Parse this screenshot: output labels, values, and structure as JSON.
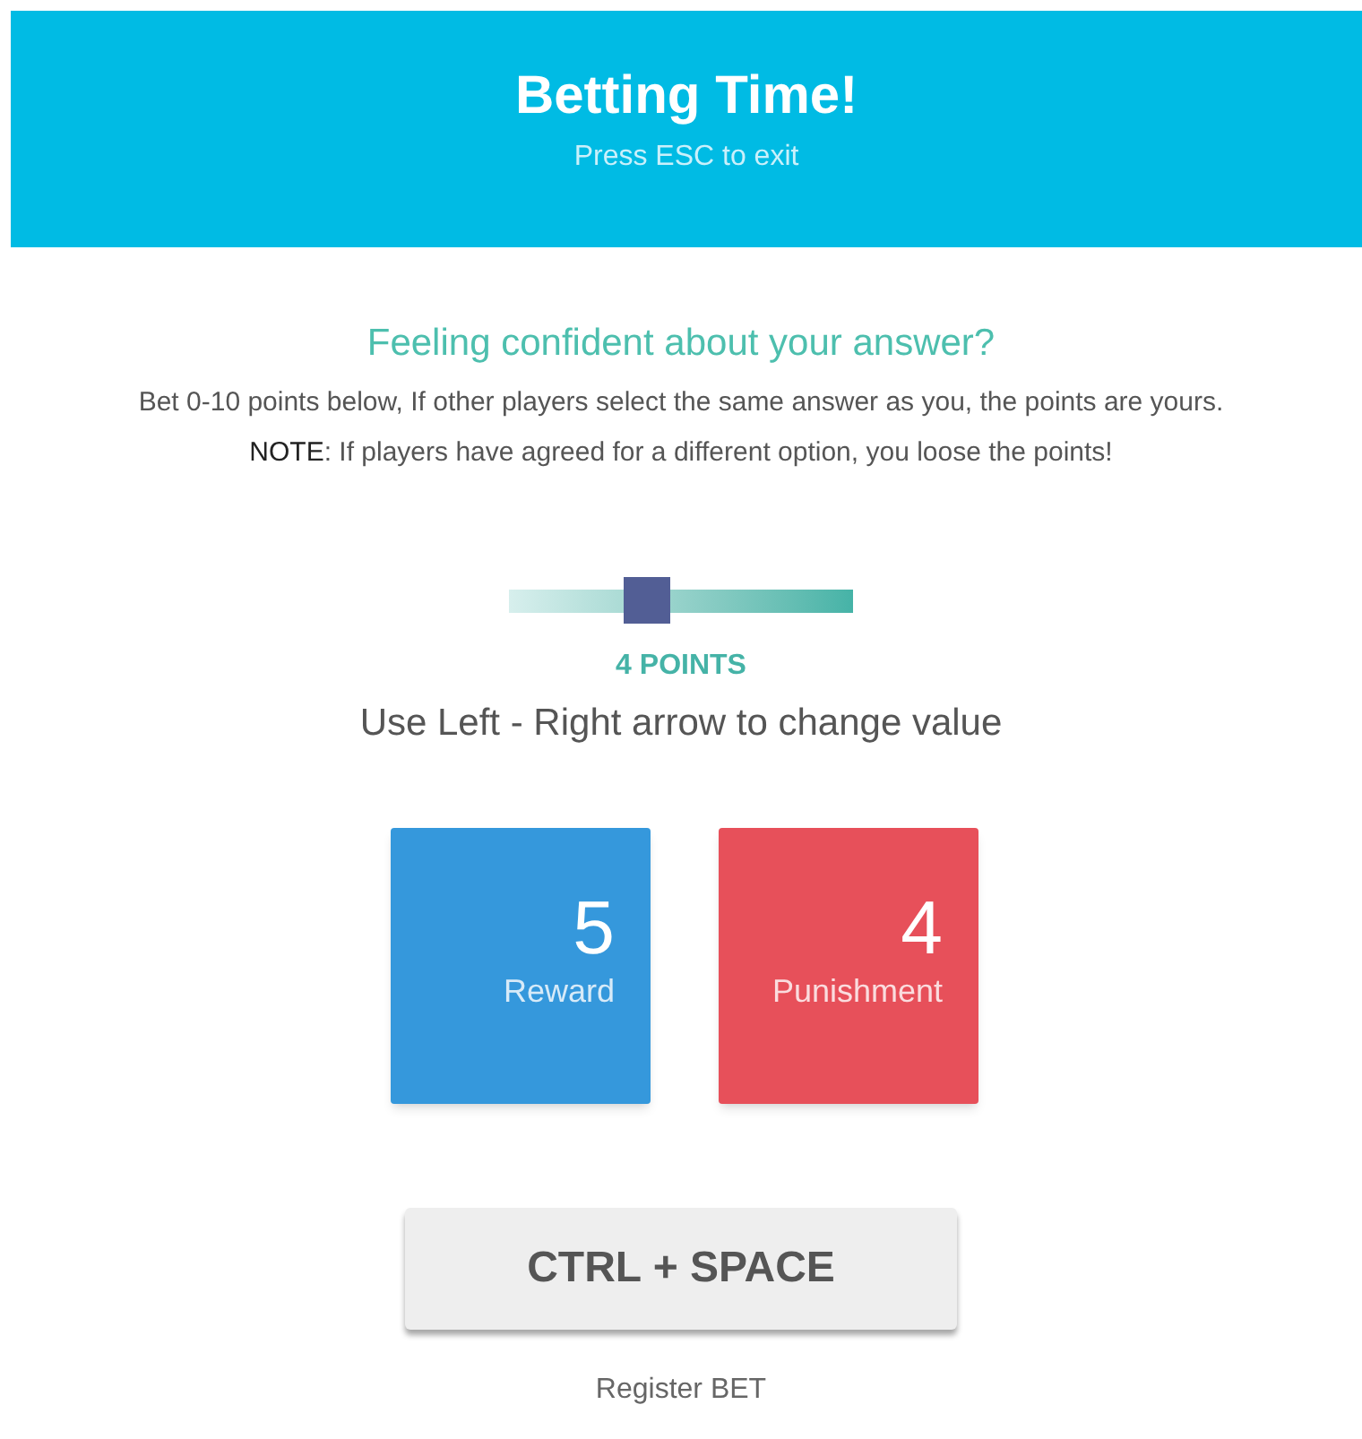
{
  "header": {
    "title": "Betting Time!",
    "subtitle": "Press ESC to exit"
  },
  "question": "Feeling confident about your answer?",
  "description": "Bet 0-10 points below, If other players select the same answer as you, the points are yours.",
  "note": "**NOTE**: If players have agreed for a different option, you loose the points!",
  "slider": {
    "level": 0.4,
    "reading": "4 POINTS",
    "hint": "Use Left - Right arrow to change value"
  },
  "cards": [
    {
      "value": "5",
      "label": "Reward",
      "color": "#3598dc"
    },
    {
      "value": "4",
      "label": "Punishment",
      "color": "#e7505a"
    }
  ],
  "button": {
    "label": "CTRL + SPACE",
    "caption": "Register BET"
  }
}
